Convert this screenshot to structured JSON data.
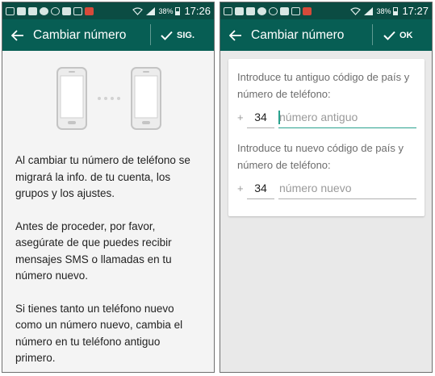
{
  "screens": [
    {
      "status_bar": {
        "battery": "38%",
        "time": "17:26"
      },
      "app_bar": {
        "title": "Cambiar número",
        "action_label": "SIG."
      },
      "paragraphs": [
        "Al cambiar tu número de teléfono se migrará la info. de tu cuenta, los grupos y los ajustes.",
        "Antes de proceder, por favor, asegúrate de que puedes recibir mensajes SMS o llamadas en tu número nuevo.",
        "Si tienes tanto un teléfono nuevo como un número nuevo, cambia el número en tu teléfono antiguo primero."
      ]
    },
    {
      "status_bar": {
        "battery": "38%",
        "time": "17:27"
      },
      "app_bar": {
        "title": "Cambiar número",
        "action_label": "OK"
      },
      "old_number": {
        "label": "Introduce tu antiguo código de país y número de teléfono:",
        "plus": "+",
        "country_code": "34",
        "placeholder": "número antiguo"
      },
      "new_number": {
        "label": "Introduce tu nuevo código de país y número de teléfono:",
        "plus": "+",
        "country_code": "34",
        "placeholder": "número nuevo"
      }
    }
  ],
  "colors": {
    "status_bar": "#0b4c43",
    "app_bar": "#075e54",
    "accent": "#2aa28e",
    "background_left": "#f4f4f4",
    "background_right": "#e9e9e9"
  },
  "icons": [
    "back-arrow-icon",
    "check-icon",
    "phone-illustration-icon",
    "wifi-icon",
    "signal-icon",
    "battery-icon"
  ]
}
